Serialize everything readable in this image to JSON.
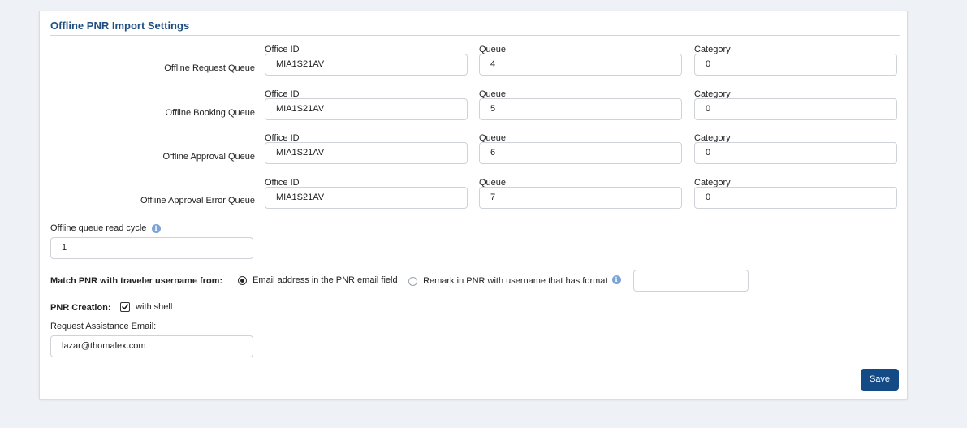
{
  "panel": {
    "title": "Offline PNR Import Settings"
  },
  "queues": [
    {
      "label": "Offline Request Queue",
      "office_id_label": "Office ID",
      "office_id": "MIA1S21AV",
      "queue_label": "Queue",
      "queue": "4",
      "category_label": "Category",
      "category": "0"
    },
    {
      "label": "Offline Booking Queue",
      "office_id_label": "Office ID",
      "office_id": "MIA1S21AV",
      "queue_label": "Queue",
      "queue": "5",
      "category_label": "Category",
      "category": "0"
    },
    {
      "label": "Offline Approval Queue",
      "office_id_label": "Office ID",
      "office_id": "MIA1S21AV",
      "queue_label": "Queue",
      "queue": "6",
      "category_label": "Category",
      "category": "0"
    },
    {
      "label": "Offline Approval Error Queue",
      "office_id_label": "Office ID",
      "office_id": "MIA1S21AV",
      "queue_label": "Queue",
      "queue": "7",
      "category_label": "Category",
      "category": "0"
    }
  ],
  "read_cycle": {
    "label": "Offline queue read cycle",
    "info_glyph": "i",
    "value": "1"
  },
  "match": {
    "label": "Match PNR with traveler username from:",
    "option_email": "Email address in the PNR email field",
    "option_remark": "Remark in PNR with username that has format",
    "info_glyph": "i",
    "selected": "email",
    "format_value": ""
  },
  "pnr_creation": {
    "label": "PNR Creation:",
    "with_shell_label": "with shell",
    "with_shell_checked": true
  },
  "assistance": {
    "label": "Request Assistance Email:",
    "value": "lazar@thomalex.com"
  },
  "actions": {
    "save_label": "Save"
  },
  "colors": {
    "accent": "#144a85",
    "title": "#1f4e82",
    "background": "#eef1f5"
  }
}
